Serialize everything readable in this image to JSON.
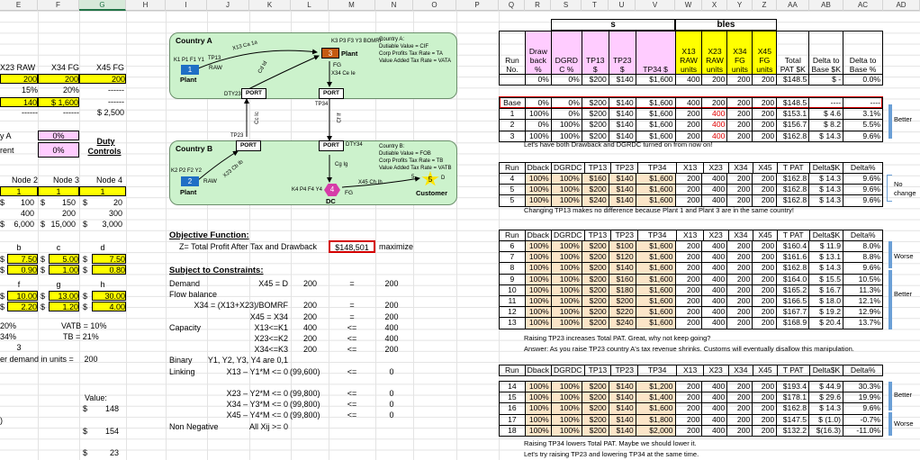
{
  "columns": [
    "E",
    "F",
    "G",
    "H",
    "I",
    "J",
    "K",
    "L",
    "M",
    "N",
    "O",
    "P",
    "Q",
    "R",
    "S",
    "T",
    "U",
    "V",
    "W",
    "X",
    "Y",
    "Z",
    "AA",
    "AB",
    "AC",
    "AD"
  ],
  "selected_column": "G",
  "left": {
    "hdr": [
      "X23 RAW",
      "X34 FG",
      "X45 FG"
    ],
    "row1": [
      "200",
      "200",
      "200"
    ],
    "row2": [
      "15%",
      "20%",
      "------"
    ],
    "row3": [
      "140",
      "$ 1,600",
      "------"
    ],
    "row3a": "$",
    "row4": [
      "------",
      "------",
      "$ 2,500"
    ],
    "countryA": "y A",
    "countryA_val": "0%",
    "parent": "rent",
    "parent_val": "0%",
    "duty1": "Duty",
    "duty2": "Controls",
    "nodes": [
      "Node 2",
      "Node 3",
      "Node 4"
    ],
    "node_ones": [
      "1",
      "1",
      "1"
    ],
    "r_100": [
      "$",
      "100",
      "$",
      "150",
      "$",
      "20"
    ],
    "r_400": [
      "400",
      "200",
      "300"
    ],
    "r_6000": [
      "$",
      "6,000",
      "$",
      "15,000",
      "$",
      "3,000"
    ],
    "bcd": [
      "b",
      "c",
      "d"
    ],
    "bcd1": [
      "$",
      "7.50",
      "$",
      "5.00",
      "$",
      "7.50"
    ],
    "bcd2": [
      "$",
      "0.90",
      "$",
      "1.00",
      "$",
      "0.80"
    ],
    "fgh": [
      "f",
      "g",
      "h"
    ],
    "fgh1": [
      "$",
      "10.00",
      "$",
      "13.00",
      "$",
      "30.00"
    ],
    "fgh2": [
      "$",
      "2.20",
      "$",
      "1.20",
      "$",
      "4.00"
    ],
    "p20": "20%",
    "vatb": "VATB = 10%",
    "p34": "34%",
    "tb": "TB = 21%",
    "three": "3",
    "demand": "er demand in units =",
    "demand_val": "200",
    "value": "Value:",
    "v1": [
      "$",
      "148"
    ],
    "v2": [
      "$",
      "154"
    ],
    "v3": [
      "$",
      "23"
    ],
    "paren": ")"
  },
  "diagram": {
    "countryA": "Country A",
    "countryB": "Country B",
    "noteA": [
      "Country A:",
      "Dutiable Value = CIF",
      "Corp Profits Tax Rate = TA",
      "Value Added Tax Rate = VATA"
    ],
    "noteB": [
      "Country B:",
      "Dutiable Value = FOB",
      "Corp Profits Tax Rate = TB",
      "Value Added Tax Rate = VATB"
    ],
    "plant1": "1",
    "plant1_lbl": "Plant",
    "k1": "K1 P1 F1 Y1",
    "plant3": "3",
    "plant3_lbl": "Plant",
    "k3": "K3 P3 F3 Y3 BOMRF",
    "plant2": "2",
    "plant2_lbl": "Plant",
    "k2": "K2 P2 F2 Y2",
    "dc4": "4",
    "dc4_lbl": "DC",
    "k4": "K4 P4 F4 Y4",
    "cust5": "5",
    "cust5_lbl": "Customer",
    "port": "PORT",
    "raw": "RAW",
    "fg": "FG",
    "x13": "X13 Ca 1a",
    "tp13": "TP13",
    "x23a": "Cd Id",
    "dty23": "DTY23",
    "tp23": "TP23",
    "cc": "Cc Ic",
    "x34": "X34 Ce Ie",
    "tp34": "TP34",
    "cf": "Cf If",
    "dty34": "DTY34",
    "cg": "Cg Ig",
    "x23b": "X23 Cb Ib",
    "x45": "X45 Ch Ih",
    "five_s": "5",
    "d": "D"
  },
  "model": {
    "objective": "Objective Function:",
    "z": "Z= Total Profit After Tax and Drawback",
    "z_val": "$148,501",
    "maximize": "maximize",
    "subject": "Subject to Constraints:",
    "rows": [
      [
        "Demand",
        "X45 = D",
        "200",
        "=",
        "200"
      ],
      [
        "Flow balance",
        "",
        "",
        "",
        ""
      ],
      [
        "",
        "X34 = (X13+X23)/BOMRF",
        "200",
        "=",
        "200"
      ],
      [
        "",
        "X45 = X34",
        "200",
        "=",
        "200"
      ],
      [
        "Capacity",
        "X13<=K1",
        "400",
        "<=",
        "400"
      ],
      [
        "",
        "X23<=K2",
        "200",
        "<=",
        "400"
      ],
      [
        "",
        "X34<=K3",
        "200",
        "<=",
        "200"
      ],
      [
        "Binary",
        "Y1, Y2, Y3, Y4 are 0,1",
        "",
        "",
        ""
      ],
      [
        "Linking",
        "X13 – Y1*M <= 0",
        "(99,600)",
        "<=",
        "0"
      ],
      [
        "",
        "",
        "",
        "",
        ""
      ],
      [
        "",
        "X23 – Y2*M <= 0",
        "(99,800)",
        "<=",
        "0"
      ],
      [
        "",
        "X34 – Y3*M <= 0",
        "(99,800)",
        "<=",
        "0"
      ],
      [
        "",
        "X45 – Y4*M <= 0",
        "(99,800)",
        "<=",
        "0"
      ],
      [
        "Non Negative",
        "All Xij >= 0",
        "",
        "",
        ""
      ]
    ]
  },
  "right": {
    "top_s": "s",
    "top_bles": "bles",
    "hdr": [
      "Run No.",
      "Draw back %",
      "DGRD C %",
      "TP13 $",
      "TP23 $",
      "TP34 $",
      "X13 RAW units",
      "X23 RAW units",
      "X34 FG units",
      "X45 FG units",
      "Total PAT $K",
      "Delta to Base $K",
      "Delta to Base %"
    ],
    "hdr_row": [
      "",
      "0%",
      "0%",
      "$200",
      "$140",
      "$1,600",
      "400",
      "200",
      "200",
      "200",
      "$148.5",
      "$   -",
      "0.0%"
    ],
    "base_rows": [
      [
        "Base",
        "0%",
        "0%",
        "$200",
        "$140",
        "$1,600",
        "400",
        "200",
        "200",
        "200",
        "$148.5",
        "----",
        "----"
      ],
      [
        "1",
        "100%",
        "0%",
        "$200",
        "$140",
        "$1,600",
        "200",
        "400",
        "200",
        "200",
        "$153.1",
        "$   4.6",
        "3.1%"
      ],
      [
        "2",
        "0%",
        "100%",
        "$200",
        "$140",
        "$1,600",
        "200",
        "400",
        "200",
        "200",
        "$156.7",
        "$   8.2",
        "5.5%"
      ],
      [
        "3",
        "100%",
        "100%",
        "$200",
        "$140",
        "$1,600",
        "200",
        "400",
        "200",
        "200",
        "$162.8",
        "$  14.3",
        "9.6%"
      ]
    ],
    "note1": "Let's have both Drawback and DGRDC turned on from now on!",
    "better1": "Better",
    "hdr2": [
      "Run",
      "Dback",
      "DGRDC",
      "TP13",
      "TP23",
      "TP34",
      "X13",
      "X23",
      "X34",
      "X45",
      "T PAT",
      "Delta$K",
      "Delta%"
    ],
    "block2": [
      [
        "4",
        "100%",
        "100%",
        "$160",
        "$140",
        "$1,600",
        "200",
        "400",
        "200",
        "200",
        "$162.8",
        "$  14.3",
        "9.6%"
      ],
      [
        "5",
        "100%",
        "100%",
        "$200",
        "$140",
        "$1,600",
        "200",
        "400",
        "200",
        "200",
        "$162.8",
        "$  14.3",
        "9.6%"
      ],
      [
        "5",
        "100%",
        "100%",
        "$240",
        "$140",
        "$1,600",
        "200",
        "400",
        "200",
        "200",
        "$162.8",
        "$  14.3",
        "9.6%"
      ]
    ],
    "note2": "Changing TP13 makes no difference because Plant 1 and Plant 3 are in the same country!",
    "nochange": [
      "No",
      "change"
    ],
    "block3": [
      [
        "6",
        "100%",
        "100%",
        "$200",
        "$100",
        "$1,600",
        "200",
        "400",
        "200",
        "200",
        "$160.4",
        "$  11.9",
        "8.0%"
      ],
      [
        "7",
        "100%",
        "100%",
        "$200",
        "$120",
        "$1,600",
        "200",
        "400",
        "200",
        "200",
        "$161.6",
        "$  13.1",
        "8.8%"
      ],
      [
        "8",
        "100%",
        "100%",
        "$200",
        "$140",
        "$1,600",
        "200",
        "400",
        "200",
        "200",
        "$162.8",
        "$  14.3",
        "9.6%"
      ],
      [
        "9",
        "100%",
        "100%",
        "$200",
        "$160",
        "$1,600",
        "200",
        "400",
        "200",
        "200",
        "$164.0",
        "$  15.5",
        "10.5%"
      ],
      [
        "10",
        "100%",
        "100%",
        "$200",
        "$180",
        "$1,600",
        "200",
        "400",
        "200",
        "200",
        "$165.2",
        "$  16.7",
        "11.3%"
      ],
      [
        "11",
        "100%",
        "100%",
        "$200",
        "$200",
        "$1,600",
        "200",
        "400",
        "200",
        "200",
        "$166.5",
        "$  18.0",
        "12.1%"
      ],
      [
        "12",
        "100%",
        "100%",
        "$200",
        "$220",
        "$1,600",
        "200",
        "400",
        "200",
        "200",
        "$167.7",
        "$  19.2",
        "12.9%"
      ],
      [
        "13",
        "100%",
        "100%",
        "$200",
        "$240",
        "$1,600",
        "200",
        "400",
        "200",
        "200",
        "$168.9",
        "$  20.4",
        "13.7%"
      ]
    ],
    "worse": "Worse",
    "better2": "Better",
    "note3a": "Raising TP23 increases Total PAT.  Great, why not keep going?",
    "note3b": "Answer:  As you raise TP23 country A's tax revenue shrinks. Customs will eventually disallow this manipulation.",
    "block4": [
      [
        "14",
        "100%",
        "100%",
        "$200",
        "$140",
        "$1,200",
        "200",
        "400",
        "200",
        "200",
        "$193.4",
        "$  44.9",
        "30.3%"
      ],
      [
        "15",
        "100%",
        "100%",
        "$200",
        "$140",
        "$1,400",
        "200",
        "400",
        "200",
        "200",
        "$178.1",
        "$  29.6",
        "19.9%"
      ],
      [
        "16",
        "100%",
        "100%",
        "$200",
        "$140",
        "$1,600",
        "200",
        "400",
        "200",
        "200",
        "$162.8",
        "$  14.3",
        "9.6%"
      ],
      [
        "17",
        "100%",
        "100%",
        "$200",
        "$140",
        "$1,800",
        "200",
        "400",
        "200",
        "200",
        "$147.5",
        "$  (1.0)",
        "-0.7%"
      ],
      [
        "18",
        "100%",
        "100%",
        "$200",
        "$140",
        "$2,000",
        "200",
        "400",
        "200",
        "200",
        "$132.2",
        "$(16.3)",
        "-11.0%"
      ]
    ],
    "better3": "Better",
    "worse2": "Worse",
    "note4a": "Raising TP34 lowers Total PAT.  Maybe we should lower it.",
    "note4b": "Let's try raising TP23 and lowering TP34 at the same time."
  }
}
